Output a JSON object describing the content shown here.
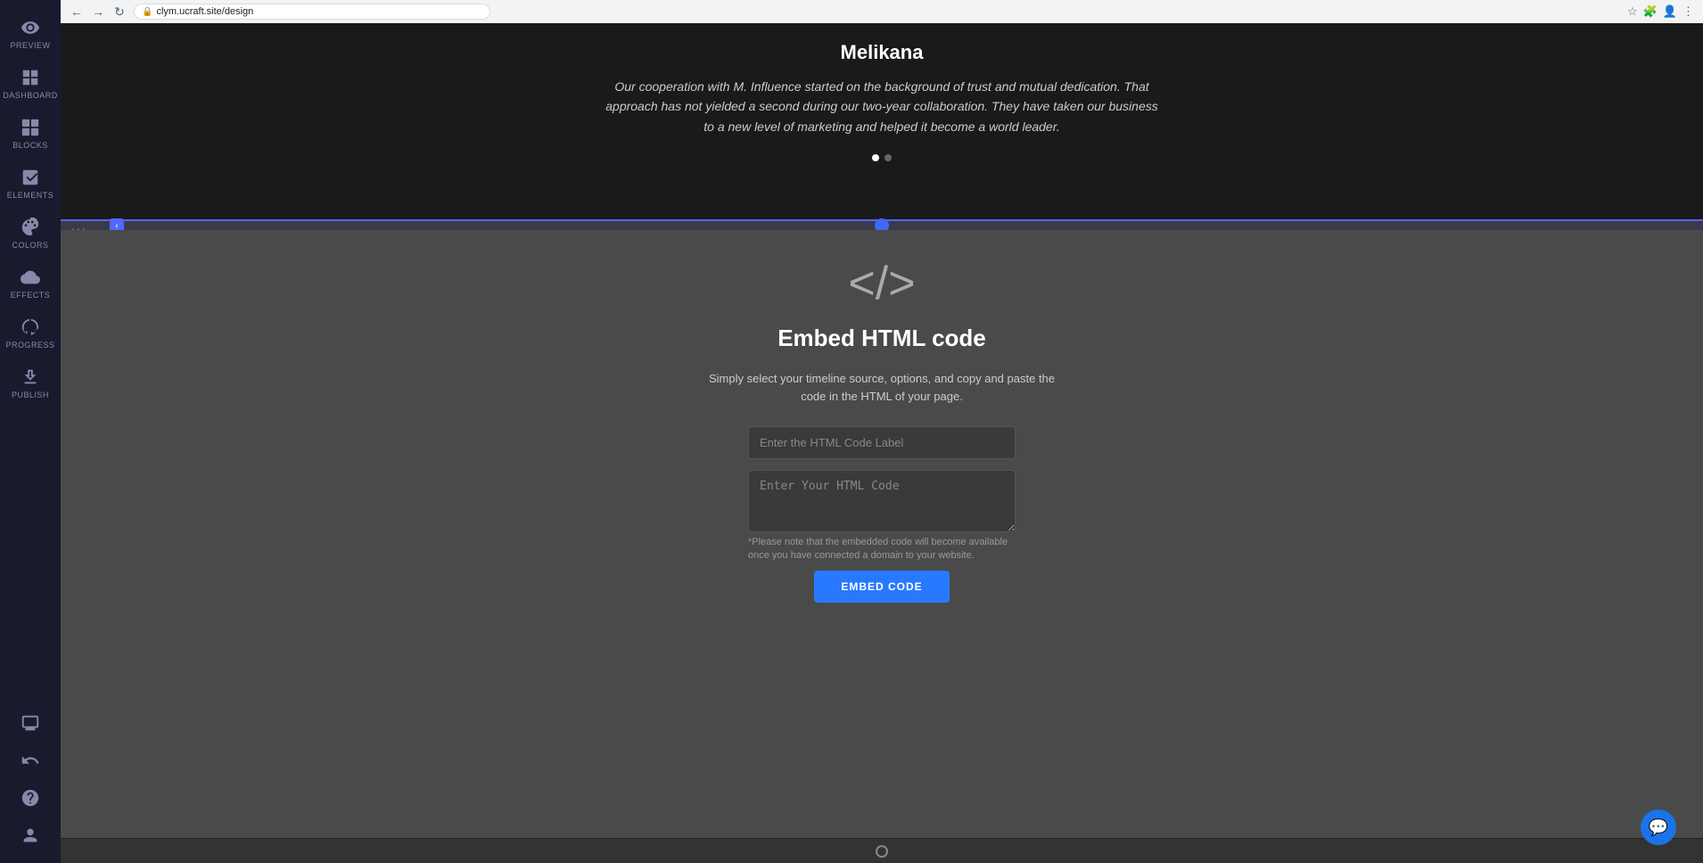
{
  "browser": {
    "url": "clym.ucraft.site/design",
    "back_label": "←",
    "forward_label": "→",
    "reload_label": "↻"
  },
  "sidebar": {
    "items": [
      {
        "id": "preview",
        "label": "PREVIEW",
        "icon": "eye"
      },
      {
        "id": "dashboard",
        "label": "DASHBOARD",
        "icon": "grid"
      },
      {
        "id": "blocks",
        "label": "BLOCKS",
        "icon": "blocks"
      },
      {
        "id": "elements",
        "label": "ELEMENTS",
        "icon": "elements"
      },
      {
        "id": "colors",
        "label": "COLORS",
        "icon": "colors"
      },
      {
        "id": "effects",
        "label": "EFFECTS",
        "icon": "effects"
      },
      {
        "id": "progress",
        "label": "PROGRESS",
        "icon": "progress"
      },
      {
        "id": "publish",
        "label": "PUBLISH",
        "icon": "publish"
      }
    ],
    "bottom_items": [
      {
        "id": "desktop",
        "icon": "desktop"
      },
      {
        "id": "undo",
        "icon": "undo"
      },
      {
        "id": "help",
        "icon": "help"
      },
      {
        "id": "user",
        "icon": "user"
      }
    ]
  },
  "testimonial": {
    "name": "Melikana",
    "text": "Our cooperation with M. Influence started on the background of trust and mutual dedication. That approach has not yielded a second during our two-year collaboration. They have taken our business to a new level of marketing and helped it become a world leader.",
    "dots": [
      {
        "active": true
      },
      {
        "active": false
      }
    ]
  },
  "embed": {
    "icon": "</>",
    "title": "Embed HTML code",
    "description": "Simply select your timeline source, options, and copy and paste the code in the HTML of your page.",
    "label_placeholder": "Enter the HTML Code Label",
    "code_placeholder": "Enter Your HTML Code",
    "note": "*Please note that the embedded code will become available once you have connected a domain to your website.",
    "button_label": "EMBED CODE"
  },
  "section_dots": "...",
  "colors": {
    "sidebar_bg": "#1a1a2e",
    "top_section_bg": "#1a1a1a",
    "embed_section_bg": "#4a4a4a",
    "resize_handle_color": "#5566ff",
    "button_color": "#2979ff"
  }
}
